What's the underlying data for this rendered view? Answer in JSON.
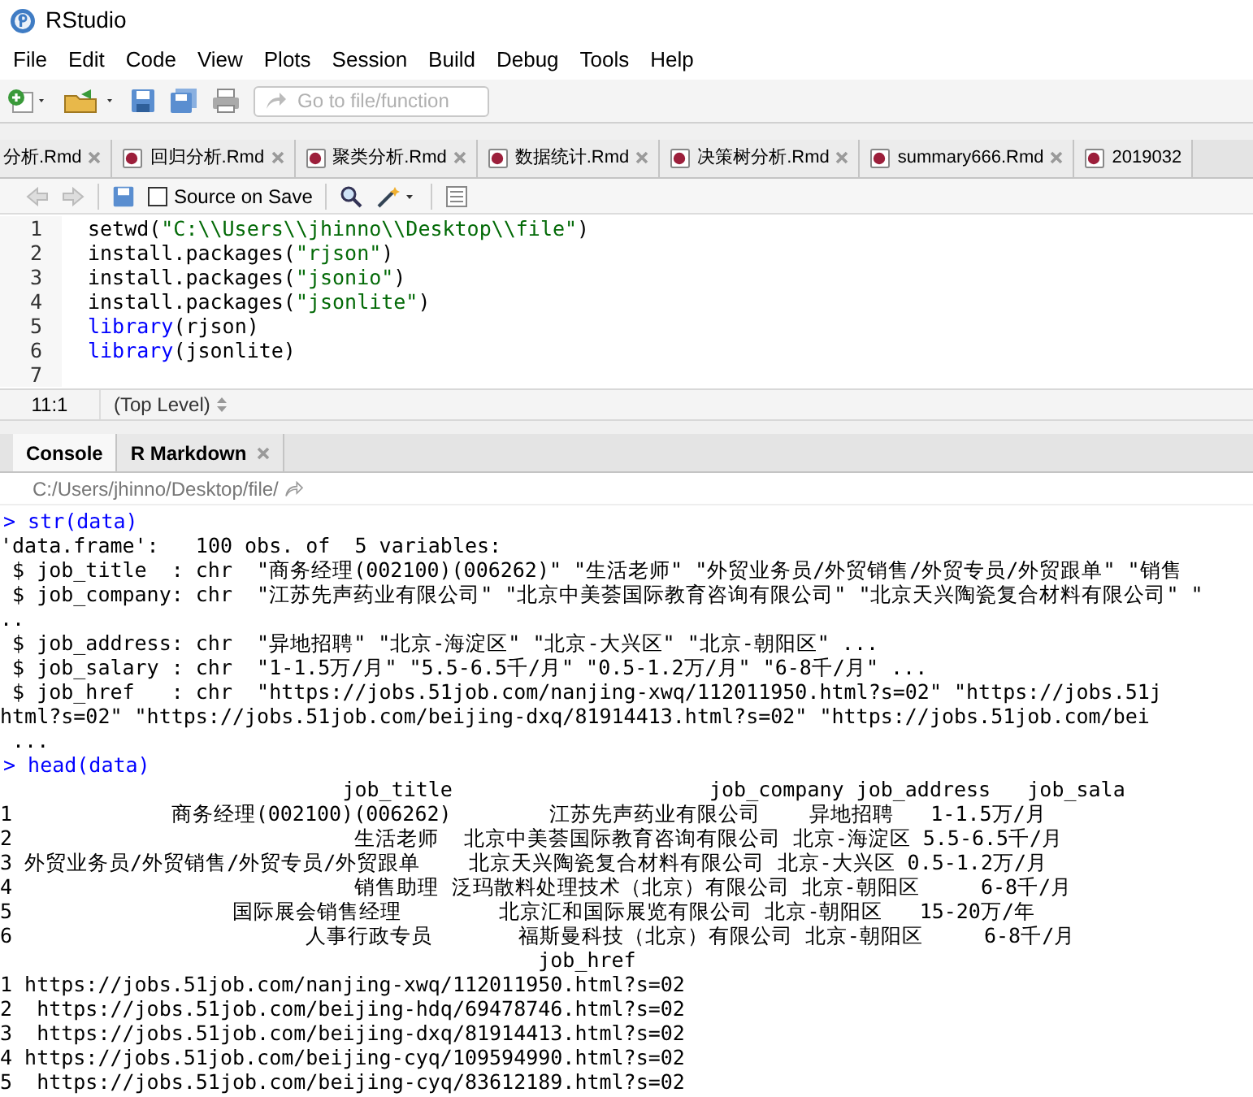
{
  "window": {
    "title": "RStudio"
  },
  "menu": [
    "File",
    "Edit",
    "Code",
    "View",
    "Plots",
    "Session",
    "Build",
    "Debug",
    "Tools",
    "Help"
  ],
  "toolbar": {
    "goto_placeholder": "Go to file/function"
  },
  "editor_tabs": [
    {
      "label": "分析.Rmd",
      "closable": true
    },
    {
      "label": "回归分析.Rmd",
      "closable": true
    },
    {
      "label": "聚类分析.Rmd",
      "closable": true
    },
    {
      "label": "数据统计.Rmd",
      "closable": true
    },
    {
      "label": "决策树分析.Rmd",
      "closable": true
    },
    {
      "label": "summary666.Rmd",
      "closable": true
    },
    {
      "label": "2019032",
      "closable": false
    }
  ],
  "editor_toolbar": {
    "source_on_save": {
      "label": "Source on Save",
      "checked": false
    }
  },
  "code_lines": [
    {
      "number": "1",
      "tokens": [
        {
          "kind": "plain",
          "text": "setwd("
        },
        {
          "kind": "string",
          "text": "\"C:\\\\Users\\\\jhinno\\\\Desktop\\\\file\""
        },
        {
          "kind": "plain",
          "text": ")"
        }
      ]
    },
    {
      "number": "2",
      "tokens": [
        {
          "kind": "plain",
          "text": "install.packages("
        },
        {
          "kind": "string",
          "text": "\"rjson\""
        },
        {
          "kind": "plain",
          "text": ")"
        }
      ]
    },
    {
      "number": "3",
      "tokens": [
        {
          "kind": "plain",
          "text": "install.packages("
        },
        {
          "kind": "string",
          "text": "\"jsonio\""
        },
        {
          "kind": "plain",
          "text": ")"
        }
      ]
    },
    {
      "number": "4",
      "tokens": [
        {
          "kind": "plain",
          "text": "install.packages("
        },
        {
          "kind": "string",
          "text": "\"jsonlite\""
        },
        {
          "kind": "plain",
          "text": ")"
        }
      ]
    },
    {
      "number": "5",
      "tokens": [
        {
          "kind": "keyword",
          "text": "library"
        },
        {
          "kind": "plain",
          "text": "(rjson)"
        }
      ]
    },
    {
      "number": "6",
      "tokens": [
        {
          "kind": "keyword",
          "text": "library"
        },
        {
          "kind": "plain",
          "text": "(jsonlite)"
        }
      ]
    },
    {
      "number": "7"
    }
  ],
  "editor_status": {
    "position": "11:1",
    "scope": "(Top Level)"
  },
  "console_tabs": [
    {
      "label": "Console",
      "selected": true,
      "closable": false
    },
    {
      "label": "R Markdown",
      "selected": false,
      "closable": true
    }
  ],
  "console_path": "C:/Users/jhinno/Desktop/file/",
  "console_lines": [
    {
      "kind": "prompt",
      "text": "> str(data)"
    },
    {
      "kind": "output",
      "text": "'data.frame':\t100 obs. of  5 variables:"
    },
    {
      "kind": "output",
      "text": " $ job_title  : chr  \"商务经理(002100)(006262)\" \"生活老师\" \"外贸业务员/外贸销售/外贸专员/外贸跟单\" \"销售"
    },
    {
      "kind": "output",
      "text": " $ job_company: chr  \"江苏先声药业有限公司\" \"北京中美荟国际教育咨询有限公司\" \"北京天兴陶瓷复合材料有限公司\" \""
    },
    {
      "kind": "output",
      "text": ".."
    },
    {
      "kind": "output",
      "text": " $ job_address: chr  \"异地招聘\" \"北京-海淀区\" \"北京-大兴区\" \"北京-朝阳区\" ..."
    },
    {
      "kind": "output",
      "text": " $ job_salary : chr  \"1-1.5万/月\" \"5.5-6.5千/月\" \"0.5-1.2万/月\" \"6-8千/月\" ..."
    },
    {
      "kind": "output",
      "text": " $ job_href   : chr  \"https://jobs.51job.com/nanjing-xwq/112011950.html?s=02\" \"https://jobs.51j"
    },
    {
      "kind": "output",
      "text": "html?s=02\" \"https://jobs.51job.com/beijing-dxq/81914413.html?s=02\" \"https://jobs.51job.com/bei"
    },
    {
      "kind": "output",
      "text": " ..."
    },
    {
      "kind": "prompt",
      "text": "> head(data)"
    },
    {
      "kind": "output",
      "text": "                            job_title                     job_company job_address   job_sala"
    },
    {
      "kind": "output",
      "text": "1             商务经理(002100)(006262)        江苏先声药业有限公司    异地招聘   1-1.5万/月"
    },
    {
      "kind": "output",
      "text": "2                            生活老师  北京中美荟国际教育咨询有限公司 北京-海淀区 5.5-6.5千/月"
    },
    {
      "kind": "output",
      "text": "3 外贸业务员/外贸销售/外贸专员/外贸跟单    北京天兴陶瓷复合材料有限公司 北京-大兴区 0.5-1.2万/月"
    },
    {
      "kind": "output",
      "text": "4                            销售助理 泛玛散料处理技术（北京）有限公司 北京-朝阳区     6-8千/月"
    },
    {
      "kind": "output",
      "text": "5                  国际展会销售经理        北京汇和国际展览有限公司 北京-朝阳区   15-20万/年"
    },
    {
      "kind": "output",
      "text": "6                        人事行政专员       福斯曼科技（北京）有限公司 北京-朝阳区     6-8千/月"
    },
    {
      "kind": "output",
      "text": "                                            job_href"
    },
    {
      "kind": "output",
      "text": "1 https://jobs.51job.com/nanjing-xwq/112011950.html?s=02"
    },
    {
      "kind": "output",
      "text": "2  https://jobs.51job.com/beijing-hdq/69478746.html?s=02"
    },
    {
      "kind": "output",
      "text": "3  https://jobs.51job.com/beijing-dxq/81914413.html?s=02"
    },
    {
      "kind": "output",
      "text": "4 https://jobs.51job.com/beijing-cyq/109594990.html?s=02"
    },
    {
      "kind": "output",
      "text": "5  https://jobs.51job.com/beijing-cyq/83612189.html?s=02"
    }
  ]
}
